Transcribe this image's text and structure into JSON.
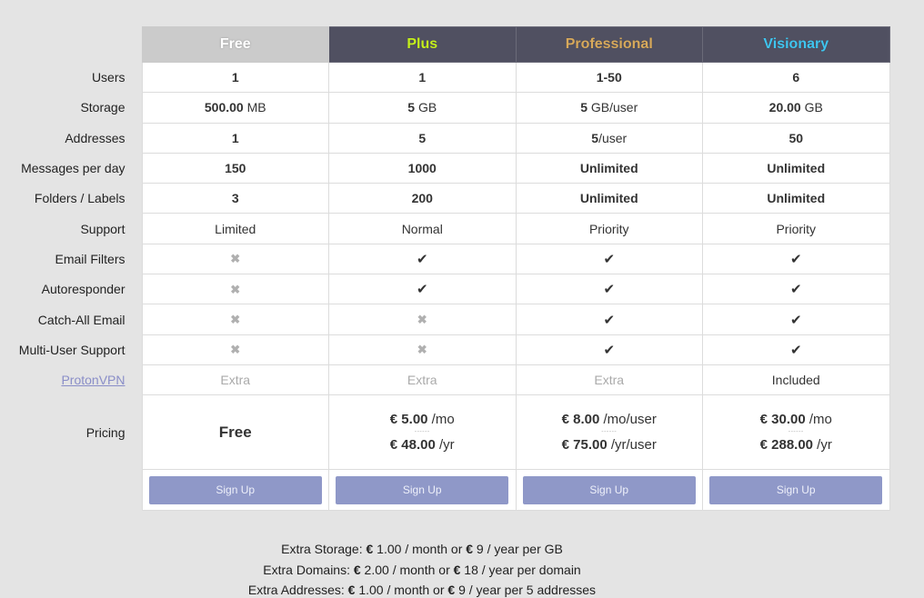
{
  "plans": [
    {
      "name": "Free",
      "color": "#ffffff"
    },
    {
      "name": "Plus",
      "color": "#c4ef1c"
    },
    {
      "name": "Professional",
      "color": "#d7a95b"
    },
    {
      "name": "Visionary",
      "color": "#3fc5ef"
    }
  ],
  "rows": {
    "users": {
      "label": "Users",
      "values": [
        "1",
        "1",
        "1-50",
        "6"
      ]
    },
    "storage": {
      "label": "Storage",
      "values": [
        {
          "num": "500.00",
          "unit": " MB"
        },
        {
          "num": "5",
          "unit": " GB"
        },
        {
          "num": "5",
          "unit": " GB/user"
        },
        {
          "num": "20.00",
          "unit": " GB"
        }
      ]
    },
    "addresses": {
      "label": "Addresses",
      "values": [
        {
          "num": "1",
          "unit": ""
        },
        {
          "num": "5",
          "unit": ""
        },
        {
          "num": "5",
          "unit": "/user"
        },
        {
          "num": "50",
          "unit": ""
        }
      ]
    },
    "messages": {
      "label": "Messages per day",
      "values": [
        "150",
        "1000",
        "Unlimited",
        "Unlimited"
      ]
    },
    "folders": {
      "label": "Folders / Labels",
      "values": [
        "3",
        "200",
        "Unlimited",
        "Unlimited"
      ]
    },
    "support": {
      "label": "Support",
      "values": [
        "Limited",
        "Normal",
        "Priority",
        "Priority"
      ]
    },
    "filters": {
      "label": "Email Filters",
      "values": [
        "✖",
        "✔",
        "✔",
        "✔"
      ]
    },
    "autoresponder": {
      "label": "Autoresponder",
      "values": [
        "✖",
        "✔",
        "✔",
        "✔"
      ]
    },
    "catchall": {
      "label": "Catch-All Email",
      "values": [
        "✖",
        "✖",
        "✔",
        "✔"
      ]
    },
    "multiuser": {
      "label": "Multi-User Support",
      "values": [
        "✖",
        "✖",
        "✔",
        "✔"
      ]
    },
    "vpn": {
      "label": "ProtonVPN",
      "values": [
        "Extra",
        "Extra",
        "Extra",
        "Included"
      ]
    }
  },
  "pricing": {
    "label": "Pricing",
    "free": "Free",
    "separator": "------",
    "plus": {
      "monthly": "€ 5.00",
      "monthly_unit": " /mo",
      "yearly": "€ 48.00",
      "yearly_unit": " /yr"
    },
    "professional": {
      "monthly": "€ 8.00",
      "monthly_unit": " /mo/user",
      "yearly": "€ 75.00",
      "yearly_unit": " /yr/user"
    },
    "visionary": {
      "monthly": "€ 30.00",
      "monthly_unit": " /mo",
      "yearly": "€ 288.00",
      "yearly_unit": " /yr"
    }
  },
  "signup_label": "Sign Up",
  "extras": [
    {
      "prefix": "Extra Storage: ",
      "cur1": "€",
      "month": " 1.00 / month or ",
      "cur2": "€",
      "year": " 9 / year per GB"
    },
    {
      "prefix": "Extra Domains: ",
      "cur1": "€",
      "month": " 2.00 / month or ",
      "cur2": "€",
      "year": " 18 / year per domain"
    },
    {
      "prefix": "Extra Addresses: ",
      "cur1": "€",
      "month": " 1.00 / month or ",
      "cur2": "€",
      "year": " 9 / year per 5 addresses"
    }
  ]
}
